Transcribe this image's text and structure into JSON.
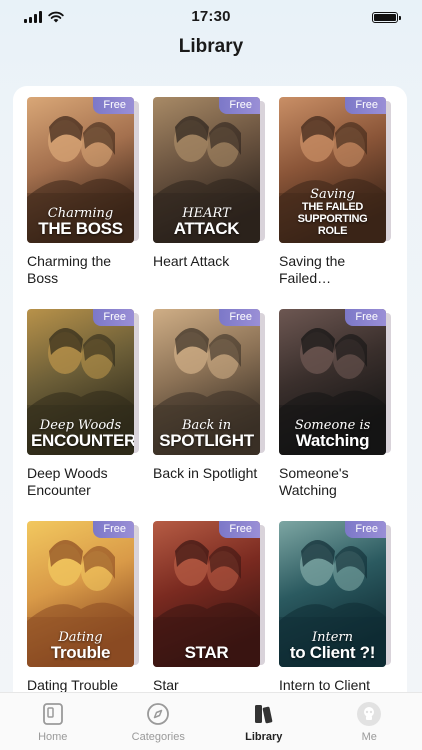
{
  "status": {
    "time": "17:30"
  },
  "header": {
    "title": "Library"
  },
  "books": [
    {
      "title": "Charming the Boss",
      "badge": "Free",
      "cover_line1": "Charming",
      "cover_line2": "THE BOSS",
      "palette": [
        "#3a2418",
        "#a4704e",
        "#d9a777"
      ]
    },
    {
      "title": "Heart Attack",
      "badge": "Free",
      "cover_line1": "HEART",
      "cover_line2": "ATTACK",
      "palette": [
        "#2b221c",
        "#6b5440",
        "#a88a66"
      ]
    },
    {
      "title": "Saving the Failed Supporting Role",
      "badge": "Free",
      "cover_line1": "Saving",
      "cover_line2": "THE FAILED SUPPORTING ROLE",
      "palette": [
        "#3b2418",
        "#8a5538",
        "#c98f66"
      ]
    },
    {
      "title": "Deep Woods Encounter",
      "badge": "Free",
      "cover_line1": "Deep Woods",
      "cover_line2": "ENCOUNTER",
      "palette": [
        "#2f2a1a",
        "#6d5f38",
        "#b8924a"
      ]
    },
    {
      "title": "Back in Spotlight",
      "badge": "Free",
      "cover_line1": "Back in",
      "cover_line2": "SPOTLIGHT",
      "palette": [
        "#3a3026",
        "#8c7256",
        "#cfae86"
      ]
    },
    {
      "title": "Someone's Watching",
      "badge": "Free",
      "cover_line1": "Someone is",
      "cover_line2": "Watching",
      "palette": [
        "#141414",
        "#3a2f2c",
        "#6d5752"
      ]
    },
    {
      "title": "Dating Trouble",
      "badge": "Free",
      "cover_line1": "Dating",
      "cover_line2": "Trouble",
      "palette": [
        "#8a4a22",
        "#d99a48",
        "#f2c85f"
      ]
    },
    {
      "title": "Star",
      "badge": "Free",
      "cover_line1": "",
      "cover_line2": "STAR",
      "palette": [
        "#3a1512",
        "#7a2a20",
        "#b65c44"
      ]
    },
    {
      "title": "Intern to Client",
      "badge": "Free",
      "cover_line1": "Intern",
      "cover_line2": "to Client ?!",
      "palette": [
        "#0f2b33",
        "#2b5a60",
        "#7da6a3"
      ]
    }
  ],
  "tabs": [
    {
      "label": "Home",
      "icon": "home-icon"
    },
    {
      "label": "Categories",
      "icon": "compass-icon"
    },
    {
      "label": "Library",
      "icon": "library-icon"
    },
    {
      "label": "Me",
      "icon": "profile-icon"
    }
  ]
}
